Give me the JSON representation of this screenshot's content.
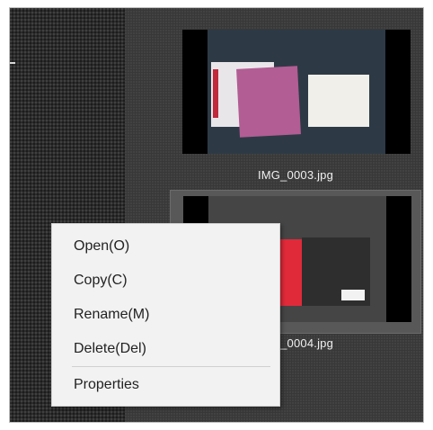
{
  "gallery": {
    "items": [
      {
        "filename": "IMG_0003.jpg"
      },
      {
        "filename": "IMG_0004.jpg"
      }
    ]
  },
  "context_menu": {
    "items": [
      {
        "label": "Open(O)"
      },
      {
        "label": "Copy(C)"
      },
      {
        "label": "Rename(M)"
      },
      {
        "label": "Delete(Del)"
      },
      {
        "label": "Properties"
      }
    ]
  },
  "colors": {
    "background": "#3a3a3a",
    "menu_background": "#f2f2f2",
    "selection_highlight": "#585858"
  }
}
